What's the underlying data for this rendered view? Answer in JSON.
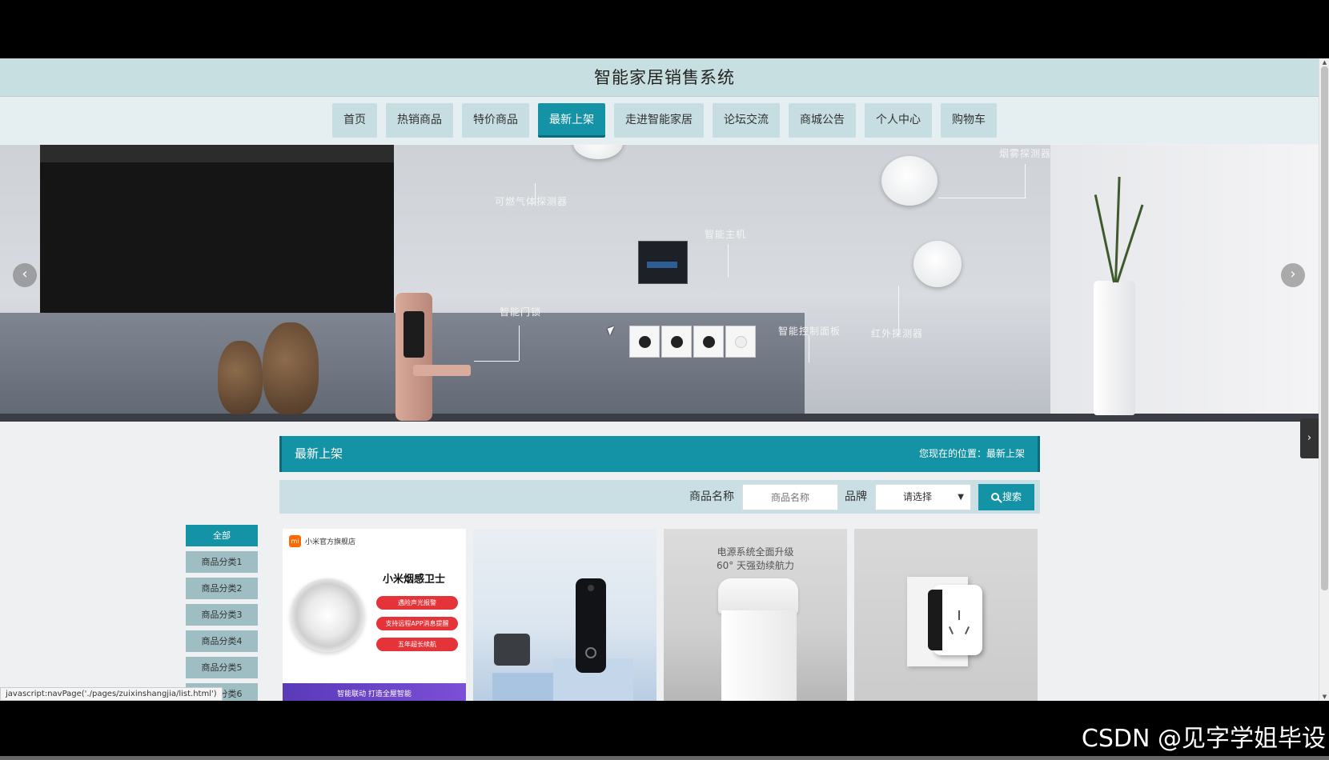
{
  "header": {
    "title": "智能家居销售系统"
  },
  "nav": {
    "items": [
      "首页",
      "热销商品",
      "特价商品",
      "最新上架",
      "走进智能家居",
      "论坛交流",
      "商城公告",
      "个人中心",
      "购物车"
    ],
    "active_index": 3
  },
  "banner": {
    "labels": {
      "gas": "可燃气体探测器",
      "smoke": "烟雾探测器",
      "hub": "智能主机",
      "lock": "智能门锁",
      "panel": "智能控制面板",
      "infrared": "红外探测器"
    },
    "prev_icon": "chevron-left-icon",
    "next_icon": "chevron-right-icon"
  },
  "section": {
    "title": "最新上架",
    "breadcrumb": "您现在的位置：最新上架"
  },
  "search": {
    "name_label": "商品名称",
    "name_placeholder": "商品名称",
    "brand_label": "品牌",
    "brand_selected": "请选择",
    "button_label": "搜索"
  },
  "categories": [
    "全部",
    "商品分类1",
    "商品分类2",
    "商品分类3",
    "商品分类4",
    "商品分类5",
    "商品分类6"
  ],
  "products": [
    {
      "store": "小米官方旗舰店",
      "name": "小米烟感卫士",
      "tags": [
        "遇险声光报警",
        "支持远程APP消息提醒",
        "五年超长续航"
      ],
      "footer": "智能联动 打造全屋智能"
    },
    {},
    {
      "headline_1": "电源系统全面升级",
      "headline_2": "60° 天强劲续航力"
    },
    {}
  ],
  "status_bar_url": "javascript:navPage('./pages/zuixinshangjia/list.html')",
  "watermark": "CSDN @见字学姐毕设",
  "colors": {
    "primary": "#1593a6",
    "header_bg": "#c8dfe2",
    "nav_bg": "#e5eef0",
    "category_bg": "#9ebec3"
  }
}
